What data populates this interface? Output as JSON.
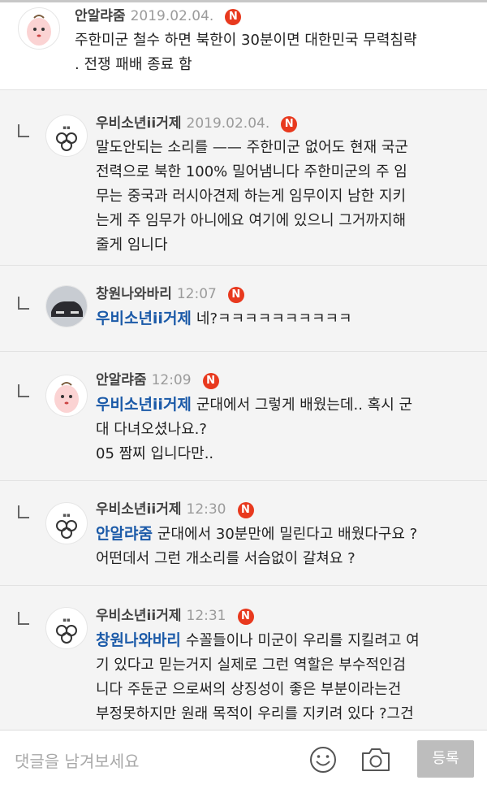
{
  "comments": [
    {
      "nick": "안알랴줌",
      "time": "2019.02.04.",
      "badge": "N",
      "text": "주한미군 철수 하면 북한이 30분이면 대한민국 무력침략\n. 전쟁 패배 종료 함"
    },
    {
      "nick": "우비소년ii거제",
      "time": "2019.02.04.",
      "badge": "N",
      "text": "말도안되는 소리를 —— 주한미군 없어도 현재 국군\n전력으로 북한 100% 밀어냄니다 주한미군의 주 임\n무는 중국과 러시아견제 하는게 임무이지 남한 지키\n는게 주 임무가 아니에요 여기에 있으니 그거까지해\n줄게 임니다"
    },
    {
      "nick": "창원나와바리",
      "time": "12:07",
      "badge": "N",
      "mention": "우비소년ii거제",
      "text": "네?ㅋㅋㅋㅋㅋㅋㅋㅋㅋㅋ"
    },
    {
      "nick": "안알랴줌",
      "time": "12:09",
      "badge": "N",
      "mention": "우비소년ii거제",
      "text": "군대에서 그렇게 배웠는데.. 혹시 군\n대 다녀오셨나요.?\n05 짬찌 입니다만.."
    },
    {
      "nick": "우비소년ii거제",
      "time": "12:30",
      "badge": "N",
      "mention": "안알랴줌",
      "text": "군대에서 30분만에 밀린다고 배웠다구요 ?\n어떤데서 그런 개소리를 서슴없이 갈쳐요 ?"
    },
    {
      "nick": "우비소년ii거제",
      "time": "12:31",
      "badge": "N",
      "mention": "창원나와바리",
      "text": "수꼴들이나 미군이 우리를 지킬려고 여\n기 있다고 믿는거지 실제로 그런 역할은 부수적인검\n니다  주둔군 으로써의 상징성이 좋은 부분이라는건\n부정못하지만 원래 목적이 우리를 지키려 있다 ?그건\n어리석은 생각이죠"
    }
  ],
  "input": {
    "placeholder": "댓글을 남겨보세요",
    "submit_label": "등록"
  },
  "colors": {
    "badge": "#e8391e",
    "mention": "#1b5aa8",
    "reply_bg": "#f4f4f4"
  },
  "icons": [
    "smiley-icon",
    "camera-icon",
    "reply-arrow-icon"
  ]
}
